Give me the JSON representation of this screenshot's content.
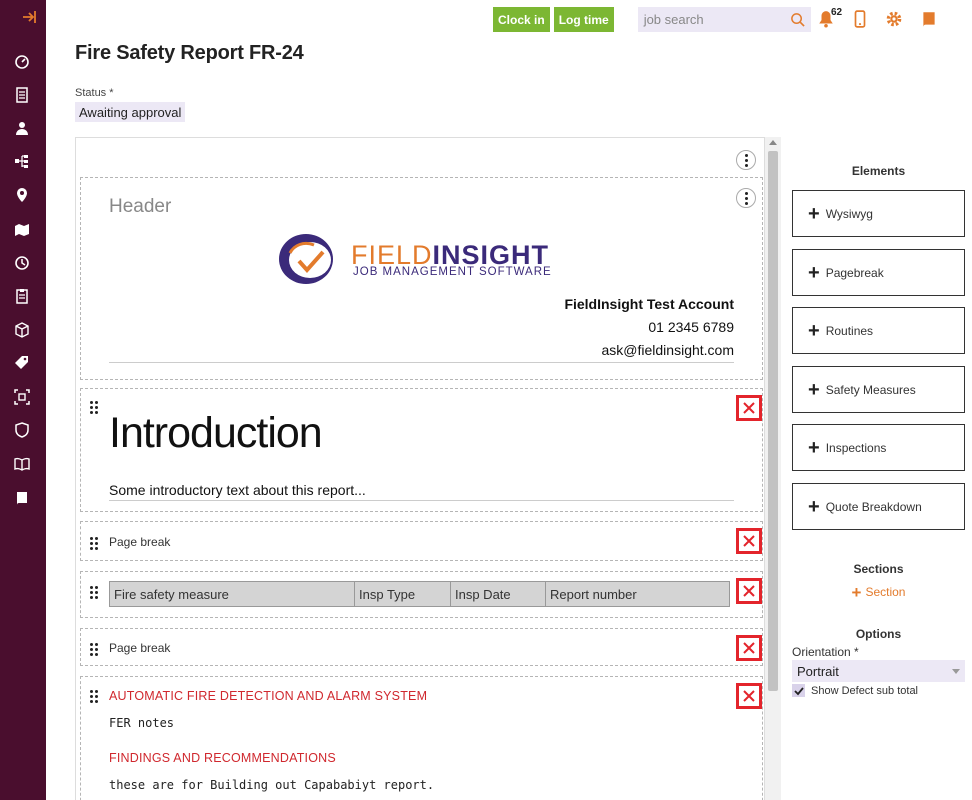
{
  "sidebar": {
    "collapse_icon": "arrow-to-right-icon",
    "items": [
      {
        "icon": "dashboard-icon"
      },
      {
        "icon": "checklist-icon"
      },
      {
        "icon": "user-icon"
      },
      {
        "icon": "workflow-icon"
      },
      {
        "icon": "map-pin-icon"
      },
      {
        "icon": "map-icon"
      },
      {
        "icon": "clock-icon"
      },
      {
        "icon": "clipboard-icon"
      },
      {
        "icon": "box-icon"
      },
      {
        "icon": "tag-icon"
      },
      {
        "icon": "scan-icon"
      },
      {
        "icon": "shield-icon"
      },
      {
        "icon": "book-icon"
      },
      {
        "icon": "notebook-icon"
      }
    ]
  },
  "topbar": {
    "clock_in": "Clock in",
    "log_time": "Log time",
    "search_placeholder": "job search",
    "notification_count": "62"
  },
  "page": {
    "title": "Fire Safety Report FR-24",
    "status_label": "Status *",
    "status_value": "Awaiting approval"
  },
  "header_block": {
    "label": "Header",
    "logo_main_1": "FIELD",
    "logo_main_2": "INSIGHT",
    "logo_sub": "JOB MANAGEMENT SOFTWARE",
    "company": "FieldInsight Test Account",
    "phone": "01 2345 6789",
    "email": "ask@fieldinsight.com"
  },
  "intro_block": {
    "heading": "Introduction",
    "text": "Some introductory text about this report..."
  },
  "pagebreak_1": {
    "label": "Page break"
  },
  "safety_table": {
    "columns": [
      "Fire safety measure",
      "Insp Type",
      "Insp Date",
      "Report number"
    ]
  },
  "pagebreak_2": {
    "label": "Page break"
  },
  "routine_block": {
    "heading_1": "AUTOMATIC FIRE DETECTION AND ALARM SYSTEM",
    "notes_1": "FER notes",
    "heading_2": "FINDINGS AND RECOMMENDATIONS",
    "notes_2": "these are for Building out Capababiyt report."
  },
  "elements_panel": {
    "title": "Elements",
    "items": [
      "Wysiwyg",
      "Pagebreak",
      "Routines",
      "Safety Measures",
      "Inspections",
      "Quote Breakdown"
    ]
  },
  "sections_panel": {
    "title": "Sections",
    "add_label": "Section"
  },
  "options_panel": {
    "title": "Options",
    "orientation_label": "Orientation *",
    "orientation_value": "Portrait",
    "defect_label": "Show Defect sub total",
    "defect_checked": true
  },
  "colors": {
    "sidebar": "#4a0e2e",
    "accent_orange": "#e37b2c",
    "green": "#7cb733",
    "delete_red": "#e3242b",
    "field_bg": "#ece8f5"
  }
}
